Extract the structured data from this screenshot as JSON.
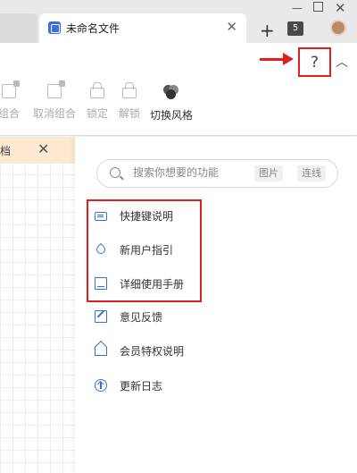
{
  "browser": {
    "tab_title": "未命名文件",
    "tab_count": "5"
  },
  "toolbar": {
    "tools": [
      {
        "label": "组合"
      },
      {
        "label": "取消组合"
      },
      {
        "label": "锁定"
      },
      {
        "label": "解锁"
      },
      {
        "label": "切换风格"
      }
    ],
    "help_symbol": "?"
  },
  "left_panel": {
    "doc_strip_text": "档",
    "close_symbol": "✕"
  },
  "help_panel": {
    "search": {
      "placeholder": "搜索你想要的功能",
      "tags": [
        "图片",
        "连线"
      ]
    },
    "items": [
      {
        "label": "快捷键说明",
        "icon": "keyboard-icon"
      },
      {
        "label": "新用户指引",
        "icon": "guide-icon"
      },
      {
        "label": "详细使用手册",
        "icon": "manual-icon"
      },
      {
        "label": "意见反馈",
        "icon": "feedback-icon"
      },
      {
        "label": "会员特权说明",
        "icon": "crown-icon"
      },
      {
        "label": "更新日志",
        "icon": "update-icon"
      }
    ]
  },
  "colors": {
    "highlight": "#e02020",
    "accent": "#3b6fd8"
  }
}
